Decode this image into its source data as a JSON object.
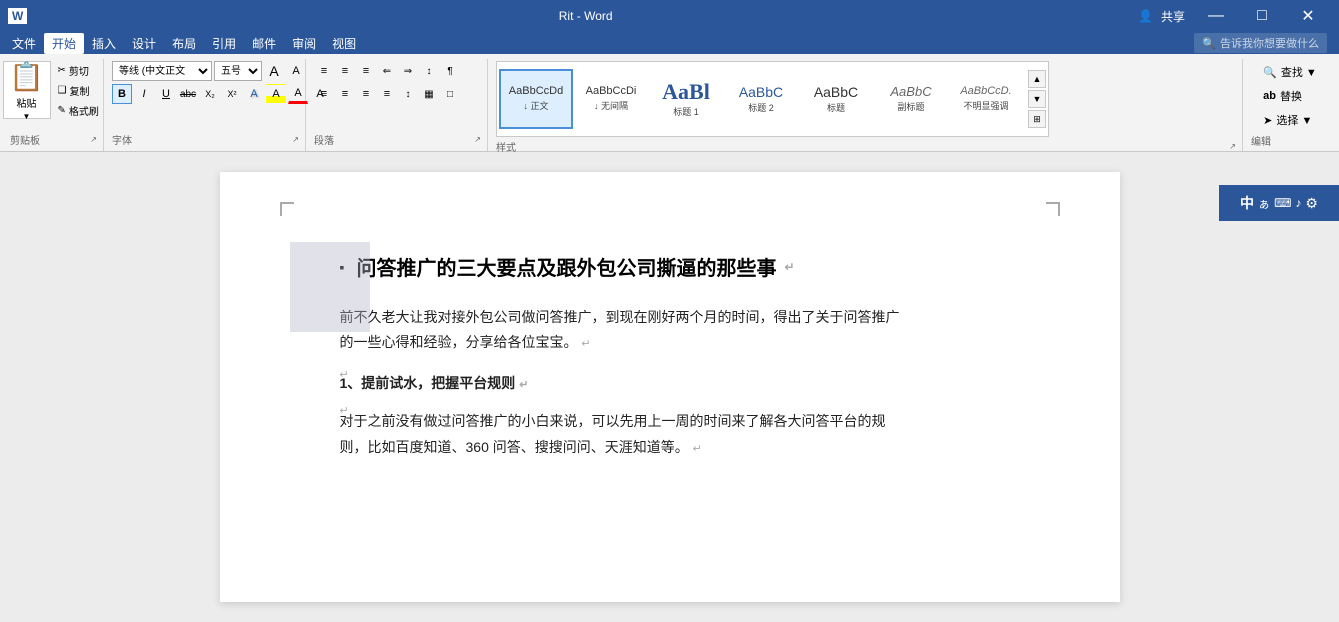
{
  "titleBar": {
    "documentName": "Rit",
    "appName": "Word",
    "shareBtn": "共享",
    "winBtns": [
      "—",
      "□",
      "✕"
    ]
  },
  "menuBar": {
    "items": [
      "文件",
      "开始",
      "插入",
      "设计",
      "布局",
      "引用",
      "邮件",
      "审阅",
      "视图"
    ],
    "activeItem": "开始",
    "searchPlaceholder": "告诉我你想要做什么"
  },
  "ribbon": {
    "clipboard": {
      "groupLabel": "剪贴板",
      "paste": "粘贴",
      "cut": "✂ 剪切",
      "copy": "❑ 复制",
      "formatPainter": "✎ 格式刷"
    },
    "font": {
      "groupLabel": "字体",
      "fontName": "等线 (中文正文",
      "fontSize": "五号",
      "fontNameLabel": "等线 (中文正",
      "fontSizeLabel": "五号",
      "buttons": [
        "B",
        "I",
        "U",
        "abc",
        "X₂",
        "X²",
        "A",
        "◐",
        "A",
        "A"
      ]
    },
    "paragraph": {
      "groupLabel": "段落",
      "listBtns": [
        "≡",
        "≡",
        "≡",
        "≡"
      ],
      "indentBtns": [
        "←",
        "→"
      ],
      "alignBtns": [
        "≡",
        "≡",
        "≡",
        "≡"
      ],
      "linespace": "↕",
      "shading": "▦",
      "border": "□"
    },
    "styles": {
      "groupLabel": "样式",
      "items": [
        {
          "preview": "正文",
          "label": "正文",
          "tag": "AaBbCcDd",
          "active": true
        },
        {
          "preview": "正文",
          "label": "无间隔",
          "tag": "AaBbCcDi"
        },
        {
          "preview": "标题1",
          "label": "标题 1",
          "tag": "AaBl",
          "large": true
        },
        {
          "preview": "标题2",
          "label": "标题 2",
          "tag": "AaBbC"
        },
        {
          "preview": "标题",
          "label": "标题",
          "tag": "AaBbC"
        },
        {
          "preview": "副标题",
          "label": "副标题",
          "tag": "AaBbC"
        },
        {
          "preview": "不明显",
          "label": "不明显强调",
          "tag": "AaBbCcD"
        }
      ]
    },
    "editing": {
      "groupLabel": "编辑",
      "find": "🔍 查找",
      "replace": "ab 替换",
      "select": "➤ 选择"
    }
  },
  "document": {
    "titleText": "问答推广的三大要点及跟外包公司撕逼的那些事",
    "paragraphs": [
      "前不久老大让我对接外包公司做问答推广，到现在刚好两个月的时间，得出了关于问答推广的一些心得和经验，分享给各位宝宝。",
      "",
      "1、提前试水，把握平台规则",
      "",
      "对于之前没有做过问答推广的小白来说，可以先用上一周的时间来了解各大问答平台的规则，比如百度知道、360 问答、搜搜问问、天涯知道等。"
    ],
    "section1Title": "1、提前试水，把握平台规则"
  },
  "ime": {
    "items": [
      "中",
      "ぁ",
      "⌨",
      "♪"
    ]
  }
}
